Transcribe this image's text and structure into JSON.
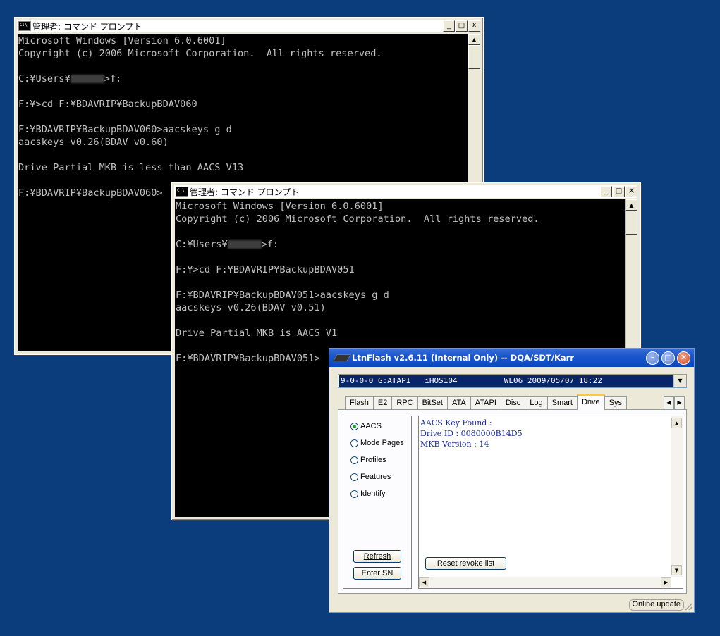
{
  "console1": {
    "title": "管理者: コマンド プロンプト",
    "buttons": [
      "_",
      "□",
      "X"
    ],
    "lines": [
      "Microsoft Windows [Version 6.0.6001]",
      "Copyright (c) 2006 Microsoft Corporation.  All rights reserved.",
      "",
      "C:¥Users¥[blur]>f:",
      "",
      "F:¥>cd F:¥BDAVRIP¥BackupBDAV060",
      "",
      "F:¥BDAVRIP¥BackupBDAV060>aacskeys g d",
      "aacskeys v0.26(BDAV v0.60)",
      "",
      "Drive Partial MKB is less than AACS V13",
      "",
      "F:¥BDAVRIP¥BackupBDAV060>"
    ]
  },
  "console2": {
    "title": "管理者: コマンド プロンプト",
    "buttons": [
      "_",
      "□",
      "X"
    ],
    "lines": [
      "Microsoft Windows [Version 6.0.6001]",
      "Copyright (c) 2006 Microsoft Corporation.  All rights reserved.",
      "",
      "C:¥Users¥[blur]>f:",
      "",
      "F:¥>cd F:¥BDAVRIP¥BackupBDAV051",
      "",
      "F:¥BDAVRIP¥BackupBDAV051>aacskeys g d",
      "aacskeys v0.26(BDAV v0.51)",
      "",
      "Drive Partial MKB is AACS V1",
      "",
      "F:¥BDAVRIP¥BackupBDAV051>"
    ]
  },
  "ltnflash": {
    "title": "LtnFlash v2.6.11 (Internal Only) -- DQA/SDT/Karr",
    "drive": "9-0-0-0 G:ATAPI   iHOS104          WL06 2009/05/07 18:22",
    "tabs": [
      "Flash",
      "E2",
      "RPC",
      "BitSet",
      "ATA",
      "ATAPI",
      "Disc",
      "Log",
      "Smart",
      "Drive",
      "Sys"
    ],
    "active_tab": "Drive",
    "radios": [
      {
        "label": "AACS",
        "selected": true
      },
      {
        "label": "Mode Pages",
        "selected": false
      },
      {
        "label": "Profiles",
        "selected": false
      },
      {
        "label": "Features",
        "selected": false
      },
      {
        "label": "Identify",
        "selected": false
      }
    ],
    "refresh_label": "Refresh",
    "enter_sn_label": "Enter SN",
    "reset_label": "Reset revoke list",
    "output": [
      "AACS Key Found :",
      "Drive ID : 0080000B14D5",
      "MKB Version : 14"
    ],
    "status": "Online update"
  }
}
